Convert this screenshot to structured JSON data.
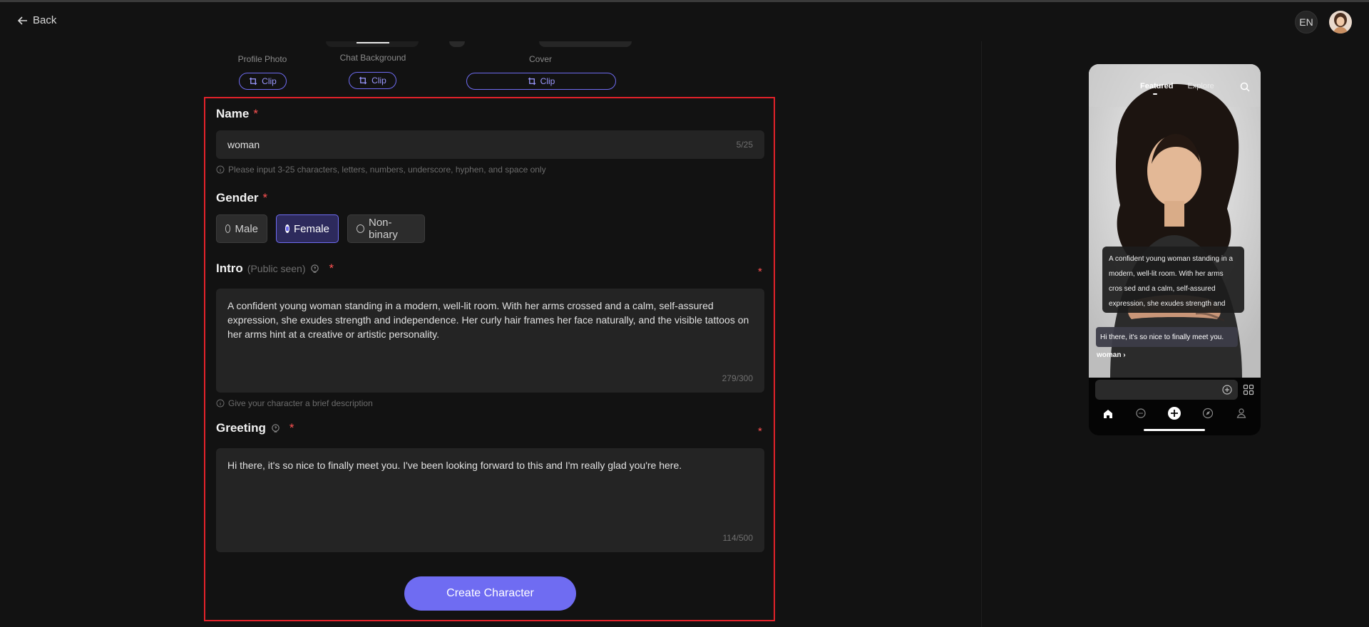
{
  "header": {
    "back_label": "Back",
    "lang": "EN"
  },
  "uploads": {
    "profile_photo_label": "Profile Photo",
    "chat_background_label": "Chat Background",
    "cover_label": "Cover",
    "clip_label": "Clip"
  },
  "form": {
    "name": {
      "label": "Name",
      "required_mark": "*",
      "value": "woman",
      "counter": "5/25",
      "hint": "Please input 3-25 characters, letters, numbers, underscore, hyphen, and space only"
    },
    "gender": {
      "label": "Gender",
      "required_mark": "*",
      "options": [
        "Male",
        "Female",
        "Non-binary"
      ],
      "selected": "Female"
    },
    "intro": {
      "label": "Intro",
      "sub_label": "(Public seen)",
      "required_mark": "*",
      "value": "A confident young woman standing in a modern, well-lit room. With her arms crossed and a calm, self-assured expression, she exudes strength and independence. Her curly hair frames her face naturally, and the visible tattoos on her arms hint at a creative or artistic personality.",
      "counter": "279/300",
      "hint": "Give your character a brief description"
    },
    "greeting": {
      "label": "Greeting",
      "required_mark": "*",
      "value": "Hi there, it's so nice to finally meet you. I've been looking forward to this and I'm really glad you're here.",
      "counter": "114/500"
    },
    "submit_label": "Create Character"
  },
  "preview": {
    "tabs": [
      "Featured",
      "Explore"
    ],
    "intro_preview": "A confident young woman standing in a modern, well-lit room. With her arms cros sed and a calm, self-assured expression, she exudes strength and independenc...",
    "greeting_preview": "Hi there, it's so nice to finally meet you.",
    "name": "woman",
    "name_suffix": "›"
  },
  "colors": {
    "accent": "#6f6cf2",
    "background": "#121212",
    "field": "#242424",
    "required": "#ff5252",
    "annotation": "#e3222a"
  }
}
